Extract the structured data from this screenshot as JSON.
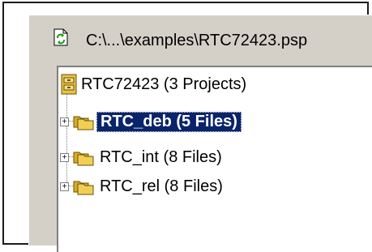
{
  "path_bar": {
    "icon": "project-file-icon",
    "path": "C:\\...\\examples\\RTC72423.psp"
  },
  "tree": {
    "root": {
      "icon": "workspace-cabinet-icon",
      "label": "RTC72423 (3 Projects)"
    },
    "projects": [
      {
        "label": "RTC_deb (5 Files)",
        "selected": true,
        "expander": "+"
      },
      {
        "label": "RTC_int (8 Files)",
        "selected": false,
        "expander": "+"
      },
      {
        "label": "RTC_rel (8 Files)",
        "selected": false,
        "expander": "+"
      }
    ]
  },
  "colors": {
    "panel": "#d4d0c8",
    "selection": "#0a246a",
    "folder": "#e8c24a"
  }
}
